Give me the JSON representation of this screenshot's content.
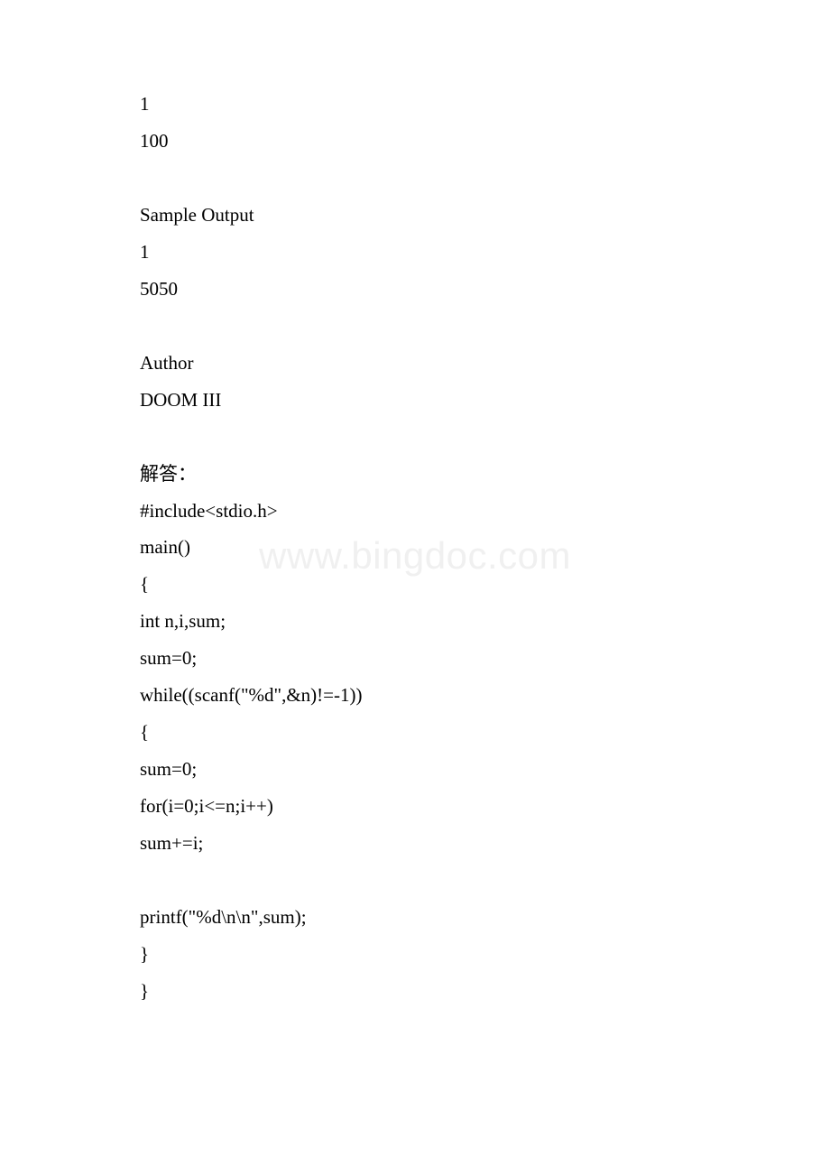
{
  "watermark": "www.bingdoc.com",
  "lines": [
    "1",
    "100",
    "",
    "Sample Output",
    "1",
    "5050",
    "",
    "Author",
    "DOOM III",
    "",
    "解答：",
    "#include<stdio.h>",
    "main()",
    "{",
    " int n,i,sum;",
    " sum=0;",
    " while((scanf(\"%d\",&n)!=-1))",
    " {",
    " sum=0;",
    " for(i=0;i<=n;i++)",
    " sum+=i;",
    "",
    " printf(\"%d\\n\\n\",sum);",
    " }",
    "}"
  ]
}
